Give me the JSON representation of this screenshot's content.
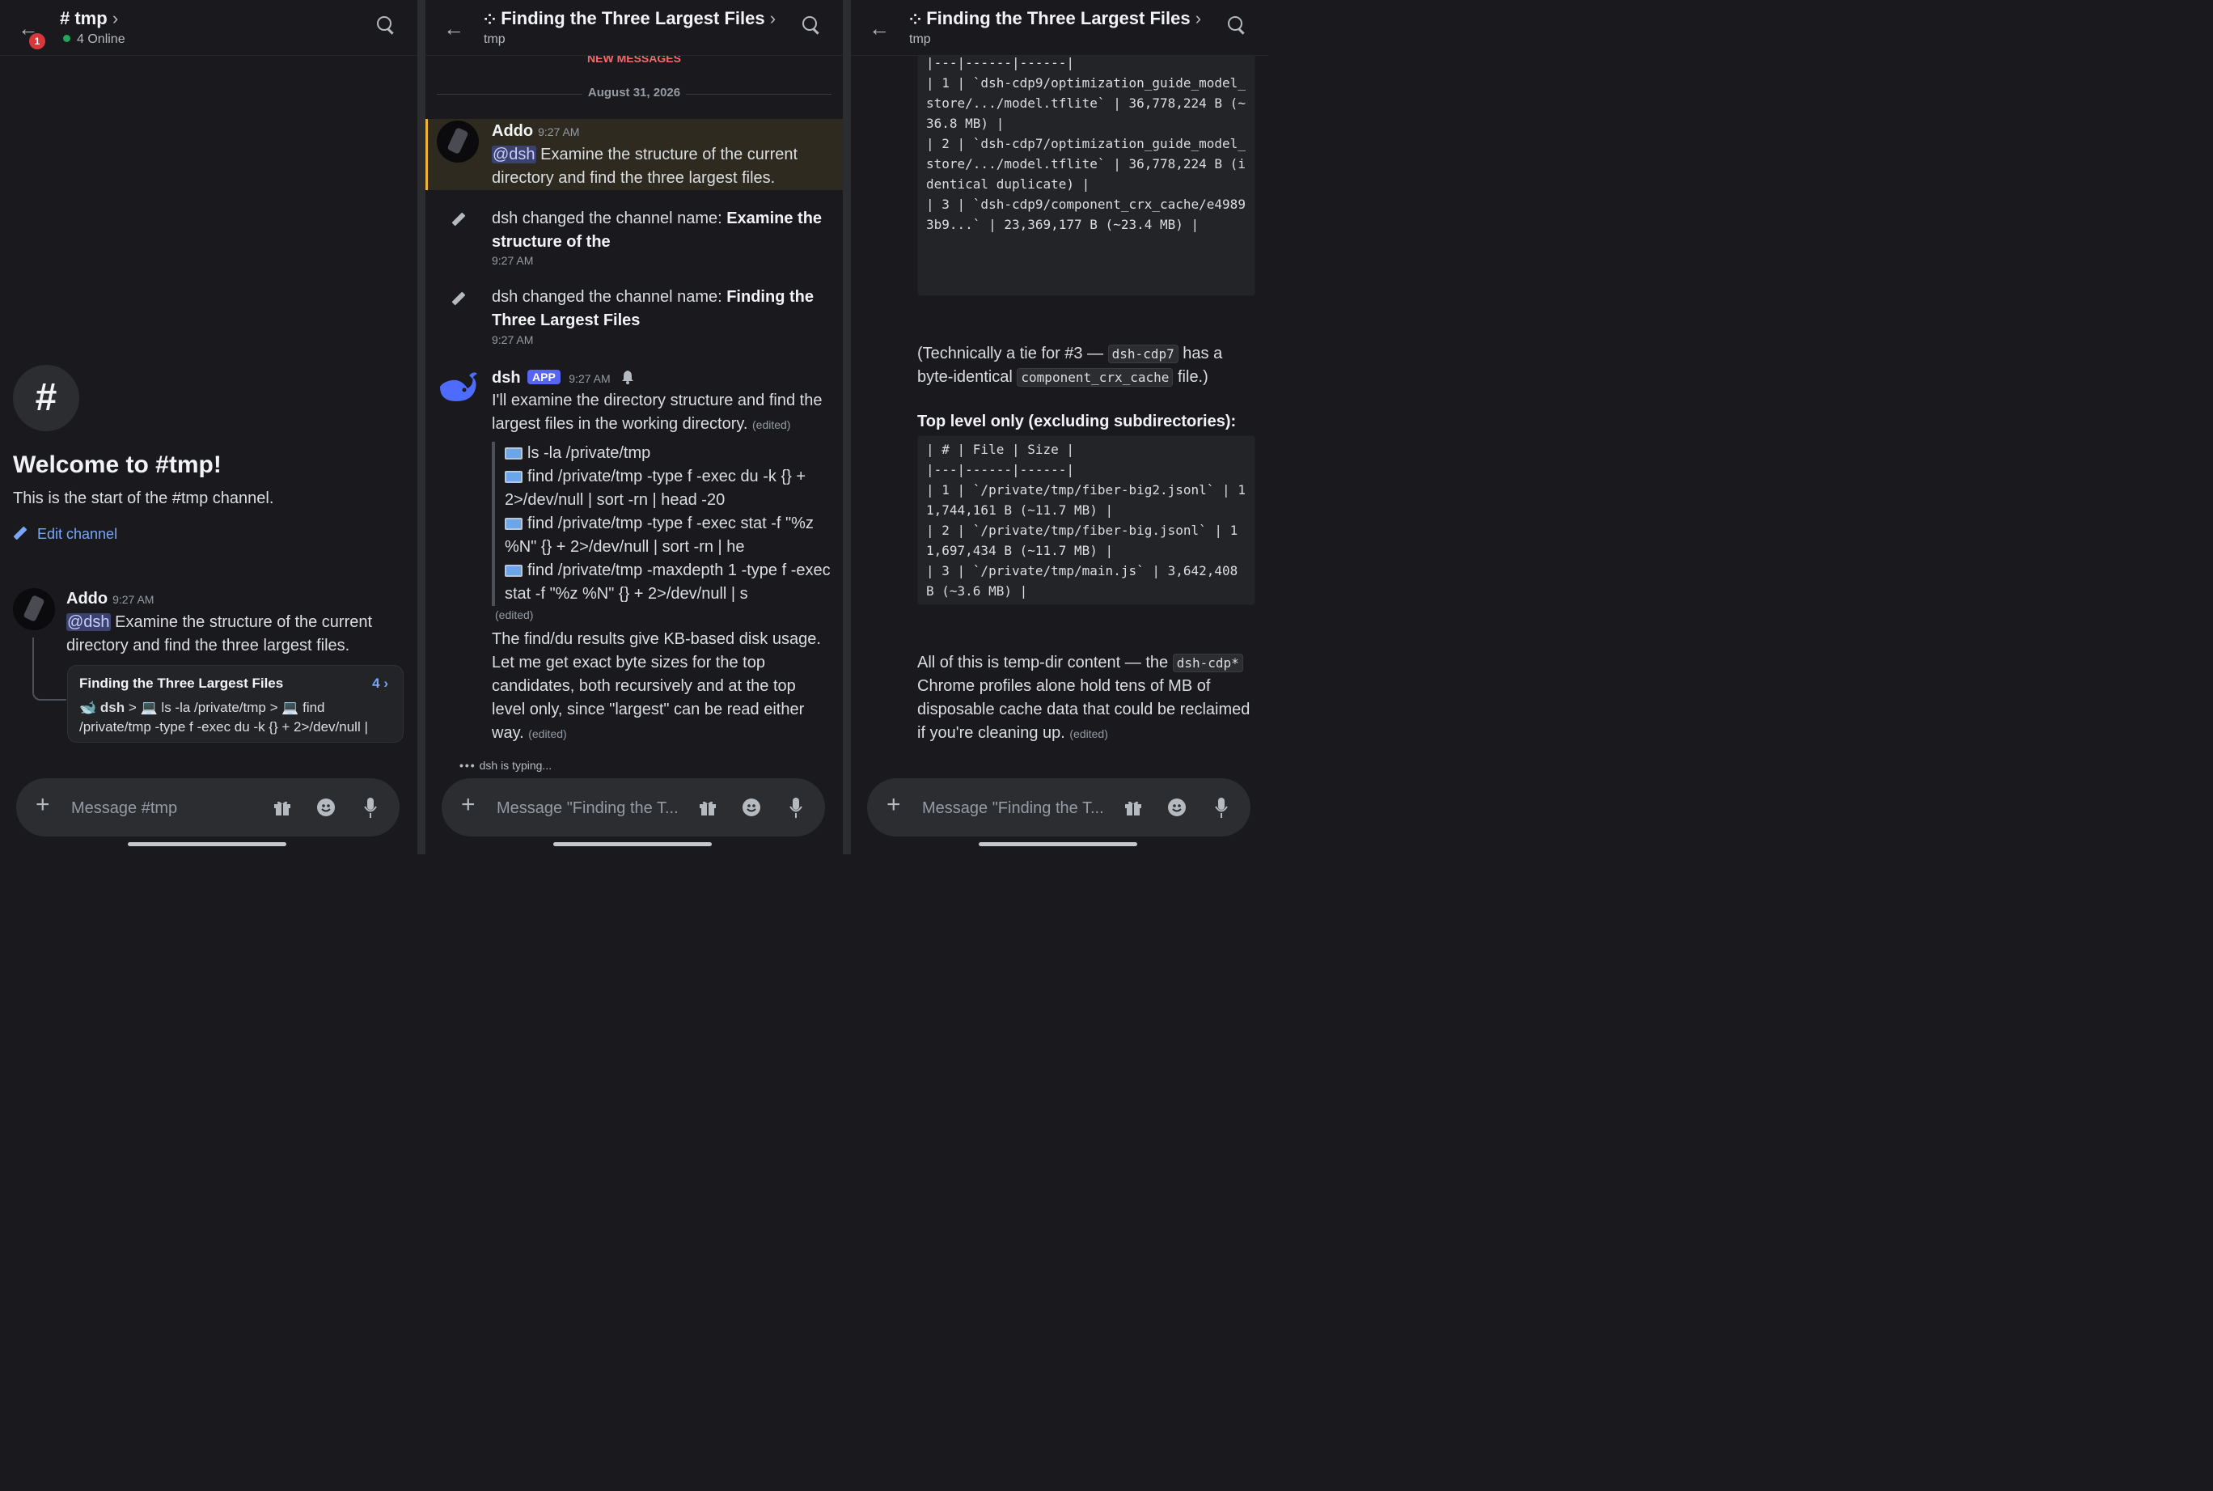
{
  "panel1": {
    "header": {
      "title": "# tmp",
      "chevron": "›",
      "status": "4 Online",
      "badge": "1"
    },
    "welcome": {
      "hash": "#",
      "title": "Welcome to #tmp!",
      "subtitle": "This is the start of the #tmp channel.",
      "edit_label": "Edit channel"
    },
    "message": {
      "author": "Addo",
      "time": "9:27 AM",
      "mention": "@dsh",
      "text": "Examine the structure of the current directory and find the three largest files."
    },
    "thread_card": {
      "title": "Finding the Three Largest Files",
      "count": "4 ›",
      "preview_author": "dsh",
      "preview_text": "> 💻 ls -la /private/tmp > 💻 find /private/tmp -type f -exec du -k {} + 2>/dev/null |"
    },
    "composer": {
      "placeholder": "Message #tmp"
    }
  },
  "panel2": {
    "header": {
      "title": "Finding the Three Largest Files",
      "chevron": "›",
      "subtitle": "tmp"
    },
    "new_messages": "NEW MESSAGES",
    "date": "August 31, 2026",
    "msg1": {
      "author": "Addo",
      "time": "9:27 AM",
      "mention": "@dsh",
      "text": "Examine the structure of the current directory and find the three largest files."
    },
    "sys1": {
      "text": "dsh changed the channel name: ",
      "bold": "Examine the structure of the",
      "time": "9:27 AM"
    },
    "sys2": {
      "text": "dsh changed the channel name: ",
      "bold": "Finding the Three Largest Files",
      "time": "9:27 AM"
    },
    "msg2": {
      "author": "dsh",
      "app_tag": "APP",
      "time": "9:27 AM",
      "text": "I'll examine the directory structure and find the largest files in the working directory.",
      "edited": "(edited)",
      "tools": [
        "ls -la /private/tmp",
        "find /private/tmp -type f -exec du -k {} + 2>/dev/null | sort -rn | head -20",
        "find /private/tmp -type f -exec stat -f \"%z %N\" {} + 2>/dev/null | sort -rn | he",
        "find /private/tmp -maxdepth 1 -type f -exec stat -f \"%z %N\" {} + 2>/dev/null | s"
      ],
      "tools_edited": "(edited)",
      "text2": "The find/du results give KB-based disk usage. Let me get exact byte sizes for the top candidates, both recursively and at the top level only, since \"largest\" can be read either way.",
      "text2_edited": "(edited)"
    },
    "typing": "dsh is typing...",
    "composer": {
      "placeholder": "Message \"Finding the T..."
    }
  },
  "panel3": {
    "header": {
      "title": "Finding the Three Largest Files",
      "chevron": "›",
      "subtitle": "tmp"
    },
    "code1": "|---|------|------|\n| 1 | `dsh-cdp9/optimization_guide_model_store/.../model.tflite` | 36,778,224 B (~36.8 MB) |\n| 2 | `dsh-cdp7/optimization_guide_model_store/.../model.tflite` | 36,778,224 B (identical duplicate) |\n| 3 | `dsh-cdp9/component_crx_cache/e49893b9...` | 23,369,177 B (~23.4 MB) |",
    "note": {
      "pre": "(Technically a tie for #3 — ",
      "code1": "dsh-cdp7",
      "mid": " has a byte-identical ",
      "code2": "component_crx_cache",
      "post": " file.)"
    },
    "toplevel_heading": "Top level only (excluding subdirectories):",
    "code2": "| # | File | Size |\n|---|------|------|\n| 1 | `/private/tmp/fiber-big2.jsonl` | 11,744,161 B (~11.7 MB) |\n| 2 | `/private/tmp/fiber-big.jsonl` | 11,697,434 B (~11.7 MB) |\n| 3 | `/private/tmp/main.js` | 3,642,408 B (~3.6 MB) |",
    "summary": {
      "pre": "All of this is temp-dir content — the ",
      "code": "dsh-cdp*",
      "post": " Chrome profiles alone hold tens of MB of disposable cache data that could be reclaimed if you're cleaning up.",
      "edited": "(edited)"
    },
    "composer": {
      "placeholder": "Message \"Finding the T..."
    }
  },
  "colors": {
    "bg": "#1a1a1e",
    "accent": "#5865f2",
    "link": "#7aa6f8",
    "danger": "#da373c",
    "online": "#23a55a",
    "new_messages": "#f06c6c",
    "highlight": "#2e2a1f",
    "highlight_bar": "#f0b232"
  }
}
